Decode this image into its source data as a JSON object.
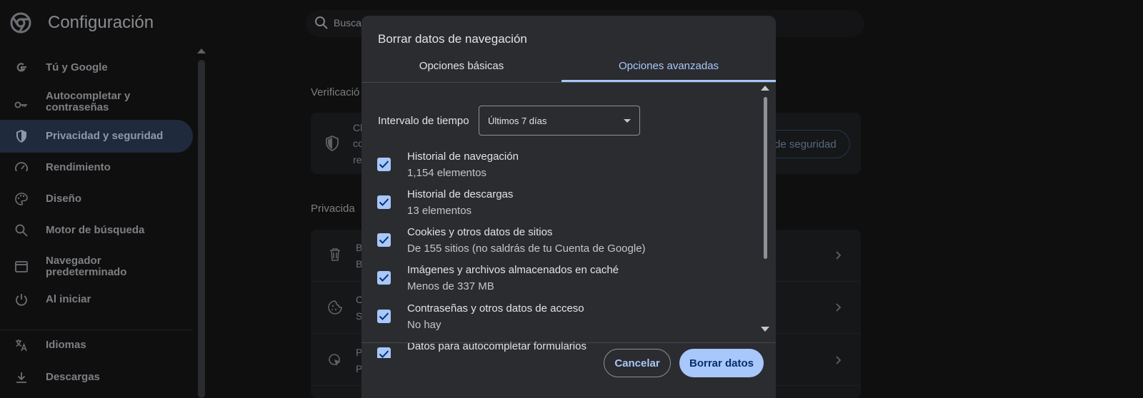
{
  "app": {
    "title": "Configuración"
  },
  "search": {
    "placeholder": "Buscar"
  },
  "sidebar": {
    "items": [
      {
        "label": "Tú y Google"
      },
      {
        "label": "Autocompletar y contraseñas"
      },
      {
        "label": "Privacidad y seguridad"
      },
      {
        "label": "Rendimiento"
      },
      {
        "label": "Diseño"
      },
      {
        "label": "Motor de búsqueda"
      },
      {
        "label": "Navegador predeterminado"
      },
      {
        "label": "Al iniciar"
      },
      {
        "label": "Idiomas"
      },
      {
        "label": "Descargas"
      }
    ],
    "active": "Privacidad y seguridad"
  },
  "background": {
    "section_1": "Verificació",
    "section_2": "Privacida",
    "safety_button": "de seguridad",
    "card_fragments": [
      "Cl",
      "co",
      "re",
      "B",
      "B",
      "C",
      "S",
      "P",
      "P"
    ]
  },
  "dialog": {
    "title": "Borrar datos de navegación",
    "tabs": [
      {
        "label": "Opciones básicas"
      },
      {
        "label": "Opciones avanzadas"
      }
    ],
    "active_tab": "Opciones avanzadas",
    "time_range": {
      "label": "Intervalo de tiempo",
      "value": "Últimos 7 días"
    },
    "items": [
      {
        "title": "Historial de navegación",
        "subtitle": "1,154 elementos",
        "checked": true
      },
      {
        "title": "Historial de descargas",
        "subtitle": "13 elementos",
        "checked": true
      },
      {
        "title": "Cookies y otros datos de sitios",
        "subtitle": "De 155 sitios (no saldrás de tu Cuenta de Google)",
        "checked": true
      },
      {
        "title": "Imágenes y archivos almacenados en caché",
        "subtitle": "Menos de 337 MB",
        "checked": true
      },
      {
        "title": "Contraseñas y otros datos de acceso",
        "subtitle": "No hay",
        "checked": true
      },
      {
        "title": "Datos para autocompletar formularios",
        "subtitle": "",
        "checked": true
      }
    ],
    "buttons": {
      "cancel": "Cancelar",
      "confirm": "Borrar datos"
    }
  },
  "colors": {
    "accent": "#a8c7fa",
    "dialog_bg": "#2b2c2f",
    "page_bg": "#0f0f0f"
  },
  "icons": [
    "chrome-logo-icon",
    "search-icon",
    "google-g-icon",
    "key-icon",
    "shield-icon",
    "gauge-icon",
    "palette-icon",
    "search-icon",
    "browser-window-icon",
    "power-icon",
    "translate-icon",
    "download-icon",
    "trash-icon",
    "cookie-icon",
    "cursor-icon",
    "chevron-right-icon",
    "check-icon",
    "dropdown-caret-icon"
  ]
}
